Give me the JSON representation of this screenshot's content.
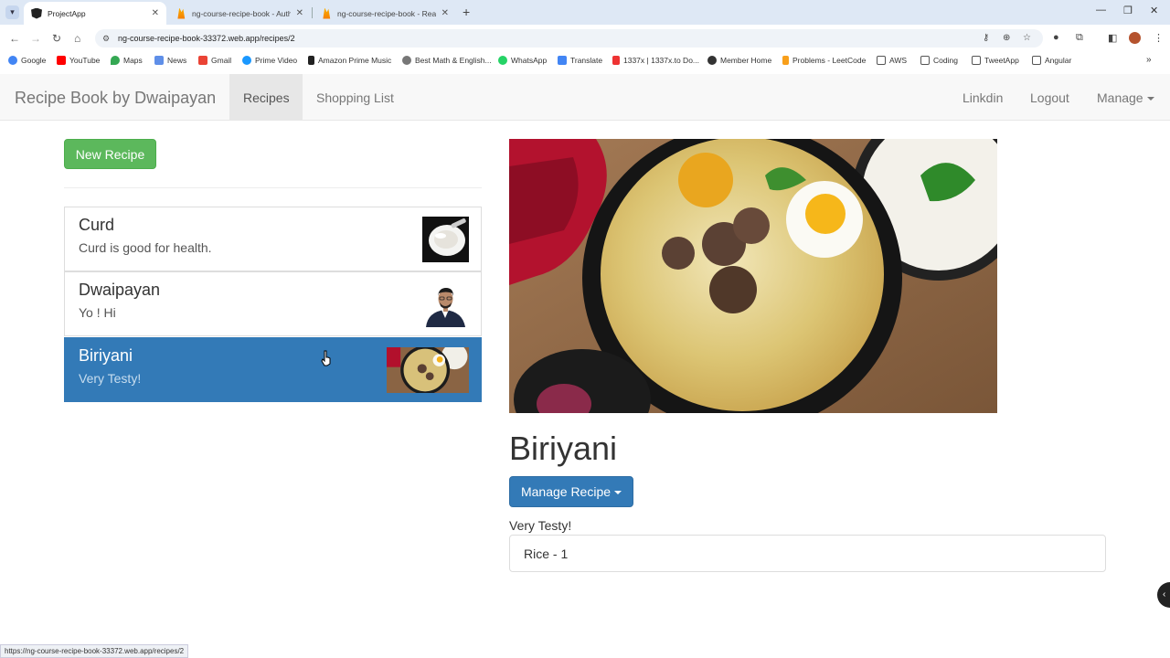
{
  "browser": {
    "tabs": [
      {
        "title": "ProjectApp"
      },
      {
        "title": "ng-course-recipe-book - Authe"
      },
      {
        "title": "ng-course-recipe-book - Realti"
      }
    ],
    "url": "ng-course-recipe-book-33372.web.app/recipes/2",
    "bookmarks": [
      "Google",
      "YouTube",
      "Maps",
      "News",
      "Gmail",
      "Prime Video",
      "Amazon Prime Music",
      "Best Math & English...",
      "WhatsApp",
      "Translate",
      "1337x | 1337x.to Do...",
      "Member Home",
      "Problems - LeetCode",
      "AWS",
      "Coding",
      "TweetApp",
      "Angular"
    ],
    "status_url": "https://ng-course-recipe-book-33372.web.app/recipes/2"
  },
  "navbar": {
    "brand": "Recipe Book by Dwaipayan",
    "links": [
      "Recipes",
      "Shopping List"
    ],
    "right_links": [
      "Linkdin",
      "Logout",
      "Manage"
    ]
  },
  "sidebar": {
    "new_recipe_label": "New Recipe",
    "recipes": [
      {
        "name": "Curd",
        "description": "Curd is good for health."
      },
      {
        "name": "Dwaipayan",
        "description": "Yo ! Hi"
      },
      {
        "name": "Biriyani",
        "description": "Very Testy!"
      }
    ]
  },
  "detail": {
    "title": "Biriyani",
    "manage_label": "Manage Recipe",
    "description": "Very Testy!",
    "ingredients": [
      "Rice - 1"
    ]
  },
  "colors": {
    "primary": "#337ab7",
    "success": "#5cb85c",
    "navbar_bg": "#f8f8f8"
  }
}
